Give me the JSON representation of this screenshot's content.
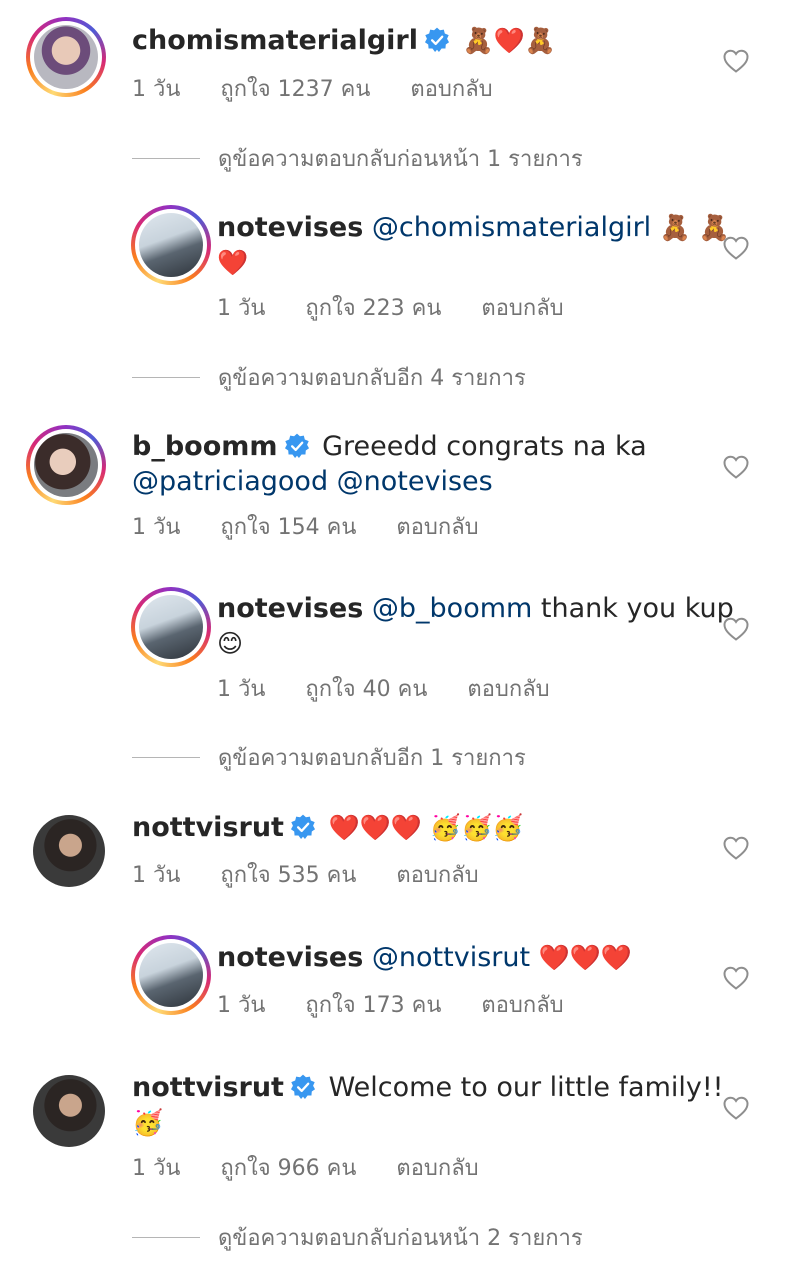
{
  "verified_color": "#3897f0",
  "comments": [
    {
      "username": "chomismaterialgirl",
      "verified": true,
      "text": "🧸❤️🧸",
      "time": "1 วัน",
      "likes_label": "ถูกใจ 1237 คน",
      "reply_label": "ตอบกลับ"
    },
    {
      "username": "notevises",
      "mention": "@chomismaterialgirl",
      "text": "🧸 🧸",
      "text2": "❤️",
      "time": "1 วัน",
      "likes_label": "ถูกใจ 223 คน",
      "reply_label": "ตอบกลับ"
    },
    {
      "username": "b_boomm",
      "verified": true,
      "text": "Greeedd congrats na ka",
      "mentions_line2": "@patriciagood @notevises",
      "time": "1 วัน",
      "likes_label": "ถูกใจ 154 คน",
      "reply_label": "ตอบกลับ"
    },
    {
      "username": "notevises",
      "mention": "@b_boomm",
      "text": "thank you kup",
      "text2": "😊",
      "time": "1 วัน",
      "likes_label": "ถูกใจ 40 คน",
      "reply_label": "ตอบกลับ"
    },
    {
      "username": "nottvisrut",
      "verified": true,
      "text": "❤️❤️❤️ 🥳🥳🥳",
      "time": "1 วัน",
      "likes_label": "ถูกใจ 535 คน",
      "reply_label": "ตอบกลับ"
    },
    {
      "username": "notevises",
      "mention": "@nottvisrut",
      "text": "❤️❤️❤️",
      "time": "1 วัน",
      "likes_label": "ถูกใจ 173 คน",
      "reply_label": "ตอบกลับ"
    },
    {
      "username": "nottvisrut",
      "verified": true,
      "text": "Welcome to our little family!!",
      "text2": "🥳",
      "time": "1 วัน",
      "likes_label": "ถูกใจ 966 คน",
      "reply_label": "ตอบกลับ"
    }
  ],
  "view_replies": [
    "ดูข้อความตอบกลับก่อนหน้า 1 รายการ",
    "ดูข้อความตอบกลับอีก 4 รายการ",
    "ดูข้อความตอบกลับอีก 1 รายการ",
    "ดูข้อความตอบกลับก่อนหน้า 2 รายการ"
  ]
}
